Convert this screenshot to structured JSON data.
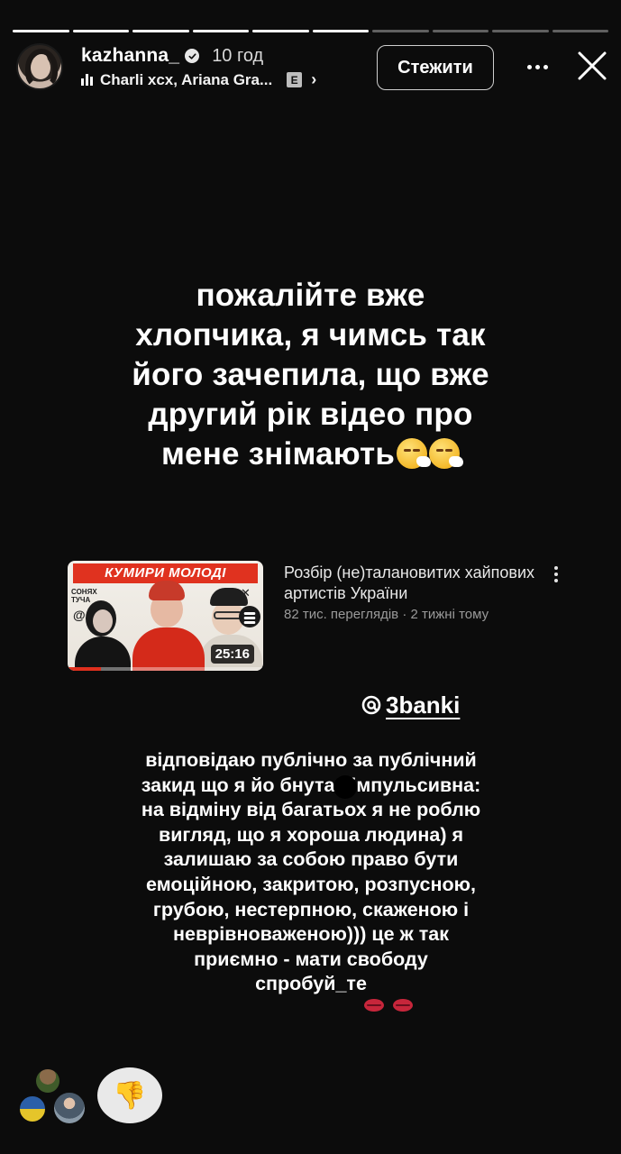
{
  "story": {
    "progress": [
      1,
      1,
      1,
      1,
      1,
      1,
      0,
      0,
      0,
      0
    ],
    "username": "kazhanna_",
    "time": "10 год",
    "music": "Charli xcx, Ariana Gra...",
    "explicit_badge": "E",
    "follow_label": "Стежити",
    "main_text": [
      "пожалійте вже",
      "хлопчика, я чимсь так",
      "його зачепила, що вже",
      "другий рік відео про",
      "мене знімають"
    ],
    "video": {
      "thumb_title": "КУМИРИ МОЛОДІ",
      "thumb_tag_line1": "СОНЯХ",
      "thumb_tag_line2": "ТУЧА",
      "x_mark": "✕",
      "duration": "25:16",
      "watched": 0.17,
      "title": "Розбір (не)талановитих хайпових артистів України",
      "subtitle": "82 тис. переглядів · 2 тижні тому"
    },
    "mention": "3banki",
    "reply_lines": [
      "відповідаю публічно за публічний",
      "закид що я йо    бнута і імпульсивна:",
      "на відміну від багатьох я не роблю",
      "вигляд, що я хороша людина) я",
      "залишаю за собою право бути",
      "емоційною, закритою, розпусною,",
      "грубою, нестерпною, скаженою і",
      "неврівноваженою))) це ж так",
      "приємно - мати свободу",
      "спробуй_те"
    ],
    "reaction_emoji": "👎"
  }
}
